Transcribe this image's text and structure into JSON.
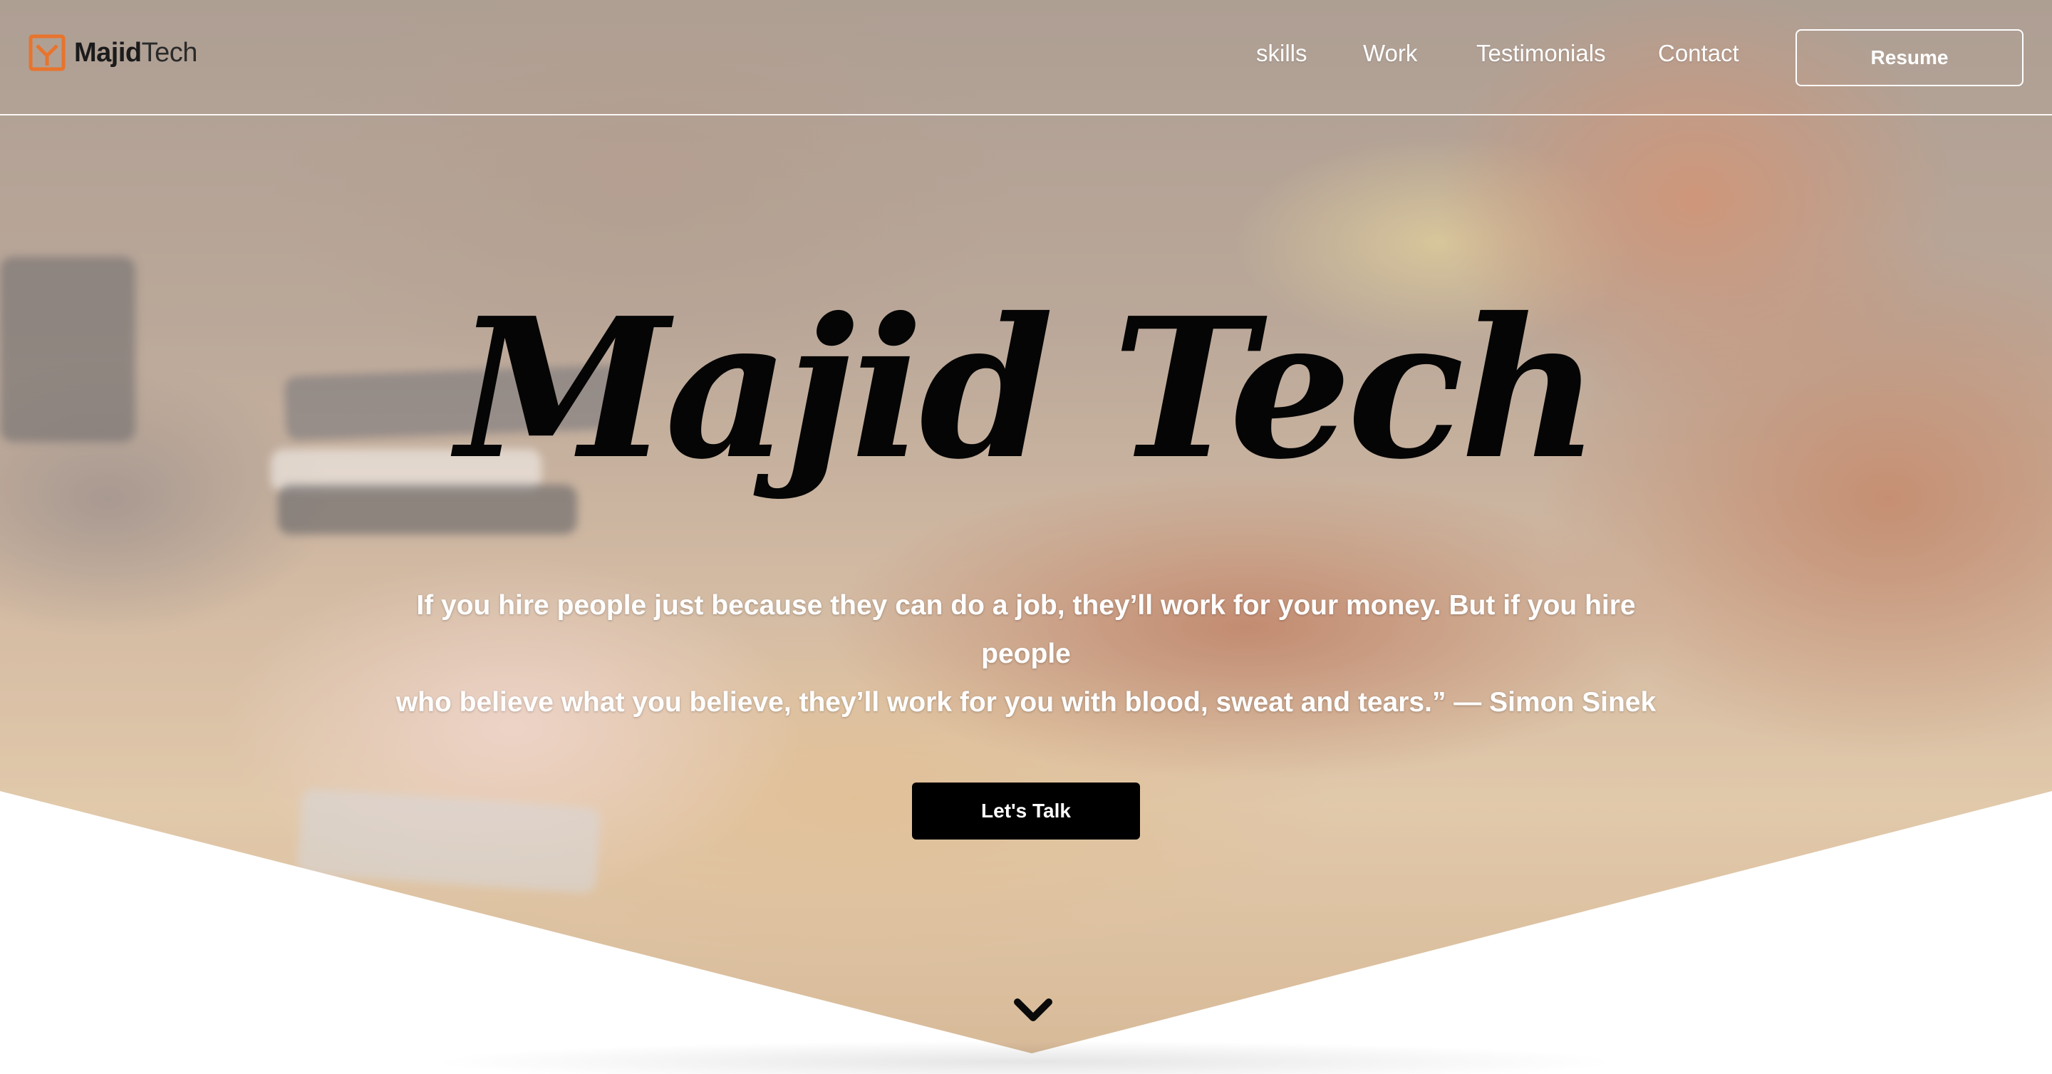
{
  "brand": {
    "name_bold": "Majid",
    "name_light": "Tech",
    "accent_color": "#E8742C",
    "logo_icon": "majidtech-logo-icon"
  },
  "nav": {
    "links": [
      "skills",
      "Work",
      "Testimonials",
      "Contact"
    ],
    "resume_label": "Resume"
  },
  "hero": {
    "title": "Majid Tech",
    "quote_line1": "If you hire people just because they can do a job, they’ll work for your money. But if you hire people",
    "quote_line2": "who believe what you believe, they’ll work for you with blood, sweat and tears.” — Simon Sinek",
    "cta_label": "Let's Talk",
    "scroll_icon": "chevron-down-icon"
  },
  "colors": {
    "title": "#050505",
    "quote": "#ffffff",
    "cta_bg": "#000000",
    "cta_text": "#ffffff",
    "nav_text": "#ffffff"
  }
}
